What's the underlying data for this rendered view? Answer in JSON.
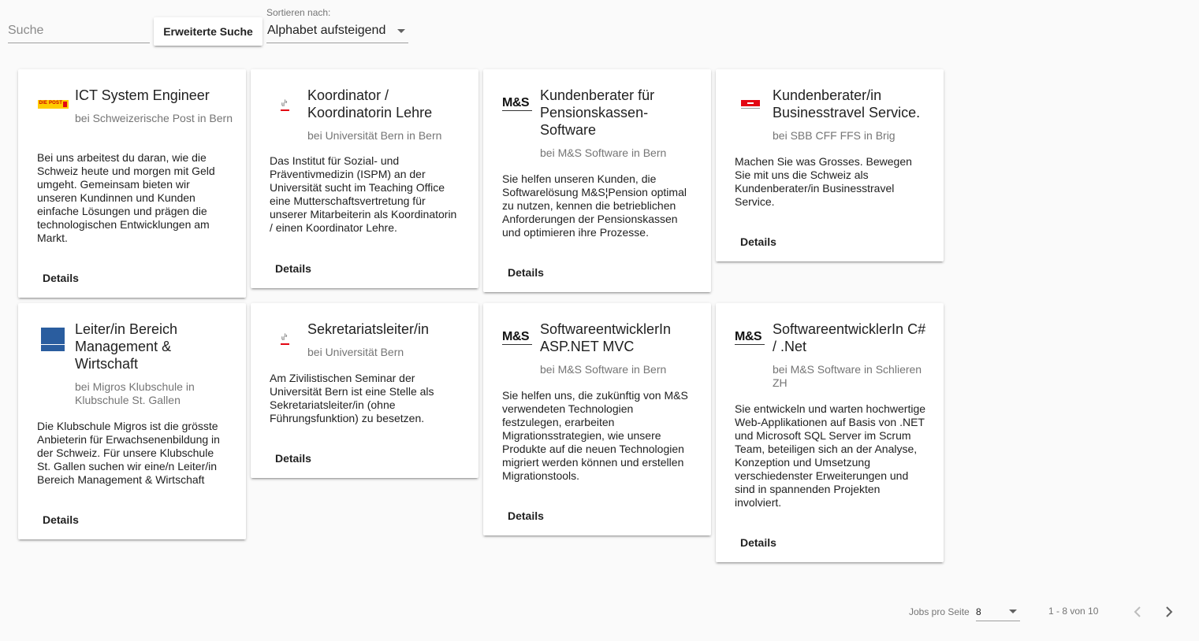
{
  "search": {
    "placeholder": "Suche",
    "value": ""
  },
  "toolbar": {
    "advanced_search_label": "Erweiterte Suche",
    "sort_label": "Sortieren nach:",
    "sort_value": "Alphabet aufsteigend"
  },
  "details_label": "Details",
  "jobs": [
    {
      "logo": "die-post-logo",
      "title": "ICT System Engineer",
      "company": "bei Schweizerische Post in Bern",
      "description": "Bei uns arbeitest du daran, wie die Schweiz heute und morgen mit Geld umgeht. Gemeinsam bieten wir unseren Kundinnen und Kunden einfache Lösungen und prägen die technologischen Entwicklungen am Markt."
    },
    {
      "logo": "universitaet-bern-logo",
      "title": "Koordinator / Koordinatorin Lehre",
      "company": "bei Universität Bern in Bern",
      "description": "Das Institut für Sozial- und Präventivmedizin (ISPM) an der Universität sucht im Teaching Office eine Mutterschaftsvertretung für unserer Mitarbeiterin als Koordinatorin / einen Koordinator Lehre."
    },
    {
      "logo": "ms-software-logo",
      "title": "Kundenberater für Pensionskassen-Software",
      "company": "bei M&S Software in Bern",
      "description": "Sie helfen unseren Kunden, die Softwarelösung M&S¦Pension optimal zu nutzen, kennen die betrieblichen Anforderungen der Pensionskassen und optimieren ihre Prozesse."
    },
    {
      "logo": "sbb-logo",
      "title": "Kundenberater/in Businesstravel Service.",
      "company": "bei SBB CFF FFS in Brig",
      "description": "Machen Sie was Grosses. Bewegen Sie mit uns die Schweiz als Kundenberater/in Businesstravel Service."
    },
    {
      "logo": "migros-klubschule-logo",
      "title": "Leiter/in Bereich Management & Wirtschaft",
      "company": "bei Migros Klubschule in Klubschule St. Gallen",
      "description": "Die Klubschule Migros ist die grösste Anbieterin für Erwachsenenbildung in der Schweiz. Für unsere Klubschule St. Gallen suchen wir eine/n Leiter/in Bereich Management & Wirtschaft"
    },
    {
      "logo": "universitaet-bern-logo",
      "title": "Sekretariatsleiter/in",
      "company": "bei Universität Bern",
      "description": "Am Zivilistischen Seminar der Universität Bern ist eine Stelle als Sekretariatsleiter/in (ohne Führungsfunktion) zu besetzen."
    },
    {
      "logo": "ms-software-logo",
      "title": "SoftwareentwicklerIn ASP.NET MVC",
      "company": "bei M&S Software in Bern",
      "description": "Sie helfen uns, die zukünftig von M&S verwendeten Technologien festzulegen, erarbeiten Migrationsstrategien, wie unsere Produkte auf die neuen Technologien migriert werden können und erstellen Migrationstools."
    },
    {
      "logo": "ms-software-logo",
      "title": "SoftwareentwicklerIn C# / .Net",
      "company": "bei M&S Software in Schlieren ZH",
      "description": "Sie entwickeln und warten hochwertige Web-Applikationen auf Basis von .NET und Microsoft SQL Server im Scrum Team, beteiligen sich an der Analyse, Konzeption und Umsetzung verschiedenster Erweiterungen und sind in spannenden Projekten involviert."
    }
  ],
  "paginator": {
    "per_page_label": "Jobs pro Seite",
    "per_page_value": "8",
    "range_label": "1 - 8 von 10"
  },
  "icons": {
    "previous": "chevron-left-icon",
    "next": "chevron-right-icon",
    "dropdown": "caret-down-icon"
  }
}
